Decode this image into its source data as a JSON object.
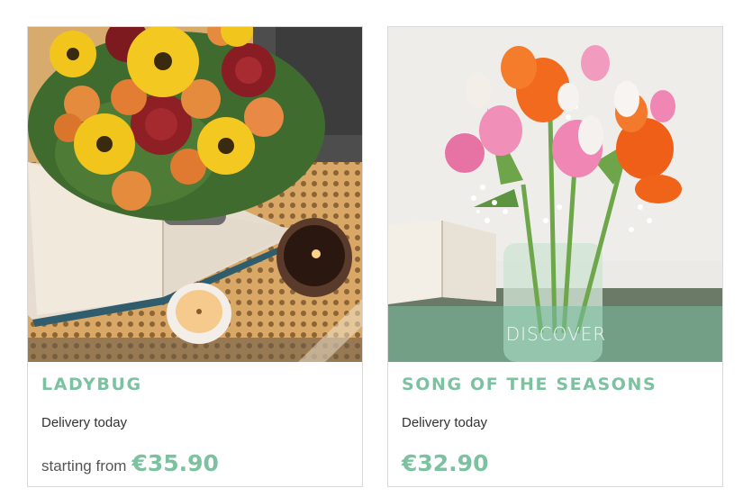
{
  "products": [
    {
      "title": "LADYBUG",
      "delivery": "Delivery today",
      "price_prefix": "starting from",
      "price": "€35.90",
      "image": "ladybug-bouquet-photo"
    },
    {
      "title": "SONG OF THE SEASONS",
      "delivery": "Delivery today",
      "price": "€32.90",
      "overlay_label": "DISCOVER",
      "image": "tulip-bouquet-photo"
    }
  ],
  "colors": {
    "accent": "#7dc2a0",
    "overlay": "#78bea0",
    "border": "#dadada",
    "text": "#333333"
  }
}
